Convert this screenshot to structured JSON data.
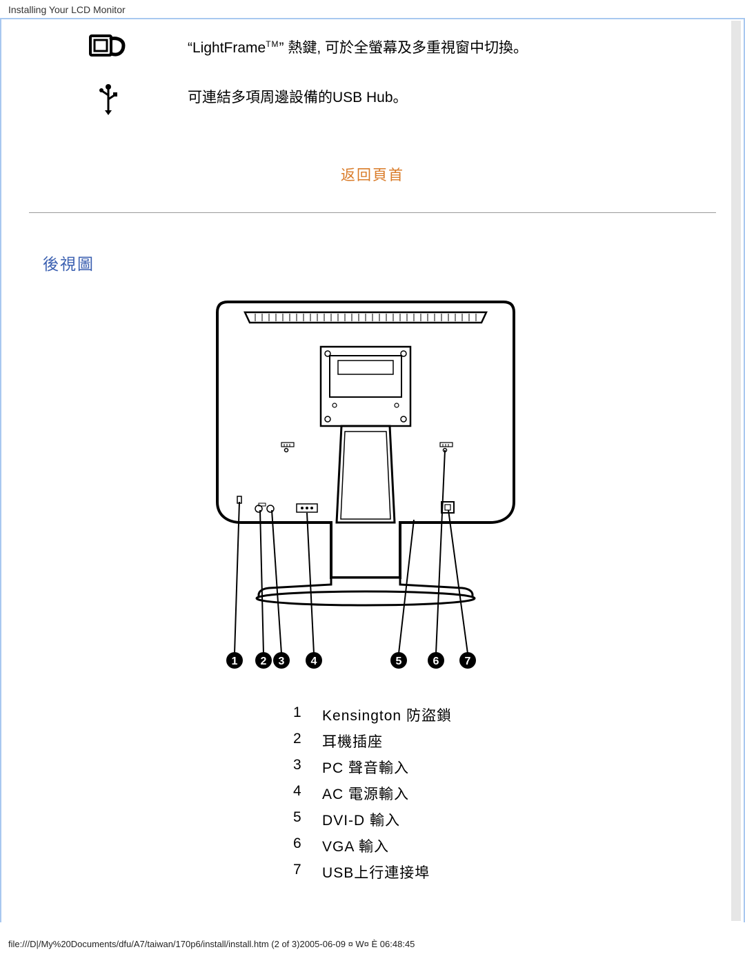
{
  "header_text": "Installing Your LCD Monitor",
  "features": [
    {
      "text": "“LightFrame",
      "tm": "TM",
      "text_after": "” 熱鍵, 可於全螢幕及多重視窗中切換。"
    },
    {
      "text": "可連結多項周邊設備的USB Hub。"
    }
  ],
  "return_link": "返回頁首",
  "section_title": "後視圖",
  "legend": [
    {
      "n": "1",
      "label": "Kensington 防盜鎖"
    },
    {
      "n": "2",
      "label": "耳機插座"
    },
    {
      "n": "3",
      "label": "PC 聲音輸入"
    },
    {
      "n": "4",
      "label": "AC 電源輸入"
    },
    {
      "n": "5",
      "label": "DVI-D 輸入"
    },
    {
      "n": "6",
      "label": "VGA 輸入"
    },
    {
      "n": "7",
      "label": "USB上行連接埠"
    }
  ],
  "footer_text": "file:///D|/My%20Documents/dfu/A7/taiwan/170p6/install/install.htm (2 of 3)2005-06-09 ¤ W¤ È 06:48:45"
}
